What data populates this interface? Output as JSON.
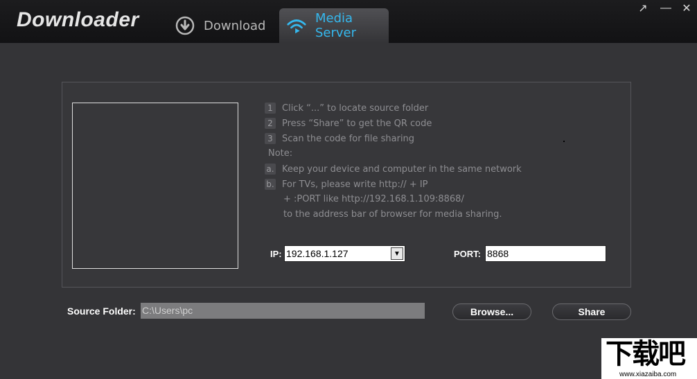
{
  "app": {
    "title": "Downloader"
  },
  "tabs": [
    {
      "label": "Download",
      "icon": "download-icon",
      "active": false
    },
    {
      "label": "Media Server",
      "icon": "wifi-icon",
      "active": true
    }
  ],
  "window_controls": {
    "popout": "↗",
    "minimize": "—",
    "close": "✕"
  },
  "instructions": {
    "steps": [
      {
        "num": "1",
        "text": "Click “...” to locate source folder"
      },
      {
        "num": "2",
        "text": "Press “Share” to get the QR code"
      },
      {
        "num": "3",
        "text": "Scan the code for file sharing"
      }
    ],
    "note_label": "Note:",
    "notes": [
      {
        "num": "a.",
        "text": "Keep your device and computer in the same network"
      },
      {
        "num": "b.",
        "text": "For TVs, please write http:// + IP"
      }
    ],
    "note_b_line2": "+ :PORT like http://192.168.1.109:8868/",
    "note_b_line3": "to the address bar of browser for media sharing."
  },
  "network": {
    "ip_label": "IP:",
    "ip_value": "192.168.1.127",
    "port_label": "PORT:",
    "port_value": "8868"
  },
  "source": {
    "label": "Source Folder:",
    "value": "C:\\Users\\pc"
  },
  "buttons": {
    "browse": "Browse...",
    "share": "Share"
  },
  "watermark": {
    "chinese": "下载吧",
    "url": "www.xiazaiba.com"
  },
  "colors": {
    "accent": "#35b8ee",
    "background": "#343437",
    "titlebar": "#161618"
  }
}
